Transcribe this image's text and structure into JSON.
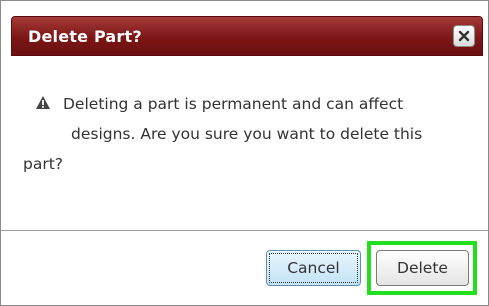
{
  "dialog": {
    "title": "Delete Part?",
    "close_icon": "close-icon",
    "warning_icon": "warning-icon",
    "message": {
      "line1": "Deleting a part is permanent and can affect",
      "line2": "designs. Are you sure you want to delete this",
      "line3": "part?"
    },
    "buttons": {
      "cancel_label": "Cancel",
      "delete_label": "Delete"
    }
  },
  "colors": {
    "titlebar": "#7c1616",
    "highlight": "#22e01e",
    "cancel_focus": "#c2e3f7"
  }
}
